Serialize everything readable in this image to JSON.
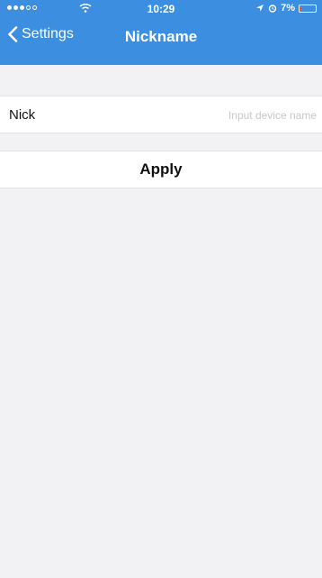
{
  "status_bar": {
    "time": "10:29",
    "battery_text": "7%",
    "signal_filled": 3,
    "signal_total": 5,
    "icons": [
      "signal-dots-icon",
      "wifi-icon",
      "location-arrow-icon",
      "alarm-icon",
      "battery-icon"
    ],
    "battery_level_fraction": 0.07
  },
  "navbar": {
    "back_label": "Settings",
    "title": "Nickname",
    "background_color": "#3b8ee0"
  },
  "form": {
    "nickname_label": "Nick",
    "nickname_value": "",
    "nickname_placeholder": "Input device name",
    "apply_label": "Apply"
  }
}
